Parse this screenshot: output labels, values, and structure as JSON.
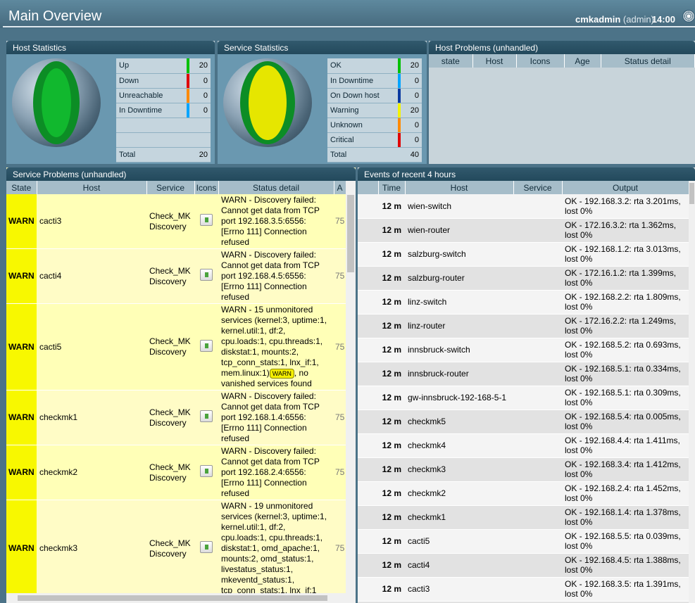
{
  "header": {
    "title": "Main Overview",
    "user": "cmkadmin",
    "role": "(admin)",
    "time": "14:00"
  },
  "host_stats": {
    "title": "Host Statistics",
    "rows": [
      {
        "label": "Up",
        "value": "20",
        "color": "#00c000"
      },
      {
        "label": "Down",
        "value": "0",
        "color": "#e00000"
      },
      {
        "label": "Unreachable",
        "value": "0",
        "color": "#ff8a00"
      },
      {
        "label": "In Downtime",
        "value": "0",
        "color": "#00a4ff"
      }
    ],
    "total_label": "Total",
    "total": "20"
  },
  "service_stats": {
    "title": "Service Statistics",
    "rows": [
      {
        "label": "OK",
        "value": "20",
        "color": "#00c000"
      },
      {
        "label": "In Downtime",
        "value": "0",
        "color": "#00a4ff"
      },
      {
        "label": "On Down host",
        "value": "0",
        "color": "#0b3aa0"
      },
      {
        "label": "Warning",
        "value": "20",
        "color": "#f2f200"
      },
      {
        "label": "Unknown",
        "value": "0",
        "color": "#ff8a00"
      },
      {
        "label": "Critical",
        "value": "0",
        "color": "#e00000"
      }
    ],
    "total_label": "Total",
    "total": "40"
  },
  "host_problems": {
    "title": "Host Problems (unhandled)",
    "columns": [
      "state",
      "Host",
      "Icons",
      "Age",
      "Status detail"
    ]
  },
  "service_problems": {
    "title": "Service Problems (unhandled)",
    "columns": [
      "State",
      "Host",
      "Service",
      "Icons",
      "Status detail",
      "A"
    ],
    "rows": [
      {
        "state": "WARN",
        "host": "cacti3",
        "service": "Check_MK Discovery",
        "detail": "WARN - Discovery failed: Cannot get data from TCP port 192.168.3.5:6556: [Errno 111] Connection refused",
        "age": "75"
      },
      {
        "state": "WARN",
        "host": "cacti4",
        "service": "Check_MK Discovery",
        "detail": "WARN - Discovery failed: Cannot get data from TCP port 192.168.4.5:6556: [Errno 111] Connection refused",
        "age": "75"
      },
      {
        "state": "WARN",
        "host": "cacti5",
        "service": "Check_MK Discovery",
        "detail": "WARN - 15 unmonitored services (kernel:3, uptime:1, kernel.util:1, df:2, cpu.loads:1, cpu.threads:1, diskstat:1, mounts:2, tcp_conn_stats:1, lnx_if:1, mem.linux:1)",
        "badge": "WARN",
        "detail_after": ", no vanished services found",
        "age": "75"
      },
      {
        "state": "WARN",
        "host": "checkmk1",
        "service": "Check_MK Discovery",
        "detail": "WARN - Discovery failed: Cannot get data from TCP port 192.168.1.4:6556: [Errno 111] Connection refused",
        "age": "75"
      },
      {
        "state": "WARN",
        "host": "checkmk2",
        "service": "Check_MK Discovery",
        "detail": "WARN - Discovery failed: Cannot get data from TCP port 192.168.2.4:6556: [Errno 111] Connection refused",
        "age": "75"
      },
      {
        "state": "WARN",
        "host": "checkmk3",
        "service": "Check_MK Discovery",
        "detail": "WARN - 19 unmonitored services (kernel:3, uptime:1, kernel.util:1, df:2, cpu.loads:1, cpu.threads:1, diskstat:1, omd_apache:1, mounts:2, omd_status:1, livestatus_status:1, mkeventd_status:1, tcp_conn_stats:1, lnx_if:1",
        "age": "75"
      }
    ]
  },
  "events": {
    "title": "Events of recent 4 hours",
    "columns": [
      "Time",
      "Host",
      "Service",
      "Output"
    ],
    "rows": [
      {
        "time": "12 m",
        "host": "wien-switch",
        "service": "",
        "output": "OK - 192.168.3.2: rta 3.201ms, lost 0%"
      },
      {
        "time": "12 m",
        "host": "wien-router",
        "service": "",
        "output": "OK - 172.16.3.2: rta 1.362ms, lost 0%"
      },
      {
        "time": "12 m",
        "host": "salzburg-switch",
        "service": "",
        "output": "OK - 192.168.1.2: rta 3.013ms, lost 0%"
      },
      {
        "time": "12 m",
        "host": "salzburg-router",
        "service": "",
        "output": "OK - 172.16.1.2: rta 1.399ms, lost 0%"
      },
      {
        "time": "12 m",
        "host": "linz-switch",
        "service": "",
        "output": "OK - 192.168.2.2: rta 1.809ms, lost 0%"
      },
      {
        "time": "12 m",
        "host": "linz-router",
        "service": "",
        "output": "OK - 172.16.2.2: rta 1.249ms, lost 0%"
      },
      {
        "time": "12 m",
        "host": "innsbruck-switch",
        "service": "",
        "output": "OK - 192.168.5.2: rta 0.693ms, lost 0%"
      },
      {
        "time": "12 m",
        "host": "innsbruck-router",
        "service": "",
        "output": "OK - 192.168.5.1: rta 0.334ms, lost 0%"
      },
      {
        "time": "12 m",
        "host": "gw-innsbruck-192-168-5-1",
        "service": "",
        "output": "OK - 192.168.5.1: rta 0.309ms, lost 0%"
      },
      {
        "time": "12 m",
        "host": "checkmk5",
        "service": "",
        "output": "OK - 192.168.5.4: rta 0.005ms, lost 0%"
      },
      {
        "time": "12 m",
        "host": "checkmk4",
        "service": "",
        "output": "OK - 192.168.4.4: rta 1.411ms, lost 0%"
      },
      {
        "time": "12 m",
        "host": "checkmk3",
        "service": "",
        "output": "OK - 192.168.3.4: rta 1.412ms, lost 0%"
      },
      {
        "time": "12 m",
        "host": "checkmk2",
        "service": "",
        "output": "OK - 192.168.2.4: rta 1.452ms, lost 0%"
      },
      {
        "time": "12 m",
        "host": "checkmk1",
        "service": "",
        "output": "OK - 192.168.1.4: rta 1.378ms, lost 0%"
      },
      {
        "time": "12 m",
        "host": "cacti5",
        "service": "",
        "output": "OK - 192.168.5.5: rta 0.039ms, lost 0%"
      },
      {
        "time": "12 m",
        "host": "cacti4",
        "service": "",
        "output": "OK - 192.168.4.5: rta 1.388ms, lost 0%"
      },
      {
        "time": "12 m",
        "host": "cacti3",
        "service": "",
        "output": "OK - 192.168.3.5: rta 1.391ms, lost 0%"
      }
    ]
  }
}
